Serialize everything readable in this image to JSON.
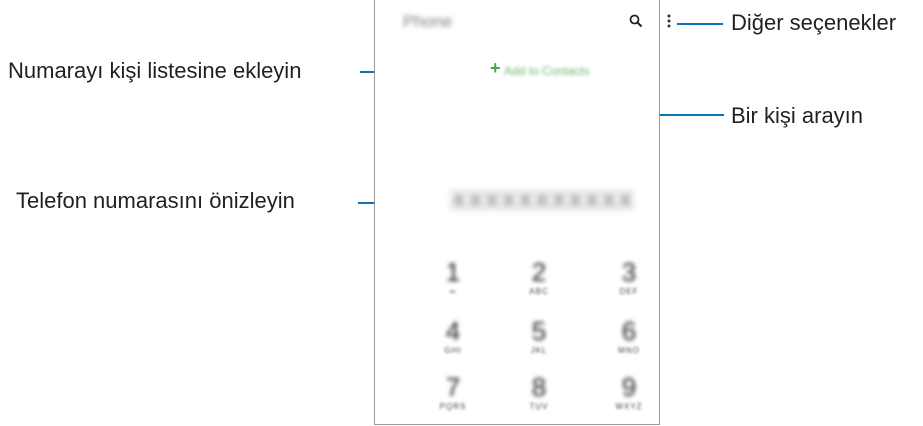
{
  "callouts": {
    "add_contact": "Numarayı kişi listesine ekleyin",
    "preview_number": "Telefon numarasını önizleyin",
    "more_options": "Diğer seçenekler",
    "search_contact": "Bir kişi arayın"
  },
  "phone_screen": {
    "app_title": "Phone",
    "add_to_contacts_label": "Add to Contacts",
    "number_preview": "XXXXXXXXXXX",
    "icons": {
      "search": "search-icon",
      "more": "more-options-icon",
      "add": "plus-icon"
    },
    "keypad": [
      {
        "digit": "1",
        "letters": "∞"
      },
      {
        "digit": "2",
        "letters": "ABC"
      },
      {
        "digit": "3",
        "letters": "DEF"
      },
      {
        "digit": "4",
        "letters": "GHI"
      },
      {
        "digit": "5",
        "letters": "JKL"
      },
      {
        "digit": "6",
        "letters": "MNO"
      },
      {
        "digit": "7",
        "letters": "PQRS"
      },
      {
        "digit": "8",
        "letters": "TUV"
      },
      {
        "digit": "9",
        "letters": "WXYZ"
      }
    ]
  },
  "colors": {
    "callout_line": "#0a74b8",
    "accent_green": "#45a84f",
    "frame": "#9a9a9a"
  }
}
